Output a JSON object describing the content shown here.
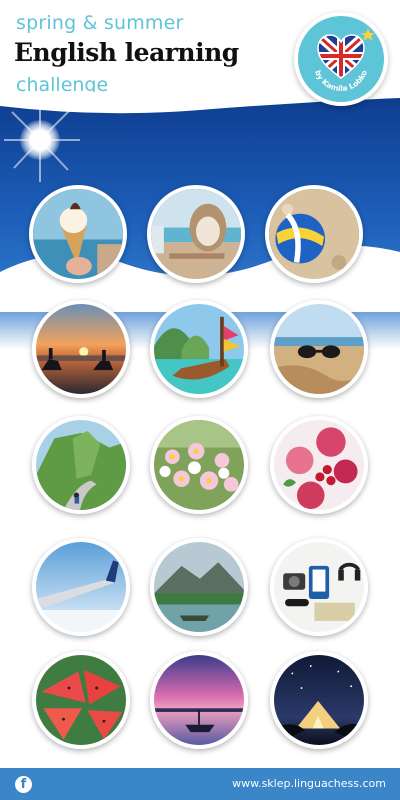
{
  "header": {
    "line1": "spring & summer",
    "line2": "English learning",
    "line3": "challenge",
    "badge_text": "by Kamila Lobko",
    "badge_icon": "heart-uk-flag-icon"
  },
  "colors": {
    "accent": "#5ec4d8",
    "sky": "#1d5eb8",
    "footer": "#3a86c8"
  },
  "photos": [
    "ice-cream-cone",
    "rattan-chair-terrace",
    "beach-volleyball",
    "horse-riders-sunset",
    "longtail-boat",
    "sunglasses-on-sand",
    "mountain-road-cyclist",
    "daisy-meadow",
    "berry-drinks",
    "airplane-wing",
    "mountain-lake",
    "travel-flatlay",
    "watermelon-slices",
    "boat-at-dusk",
    "tent-under-stars"
  ],
  "footer": {
    "facebook_glyph": "f",
    "url": "www.sklep.linguachess.com"
  }
}
